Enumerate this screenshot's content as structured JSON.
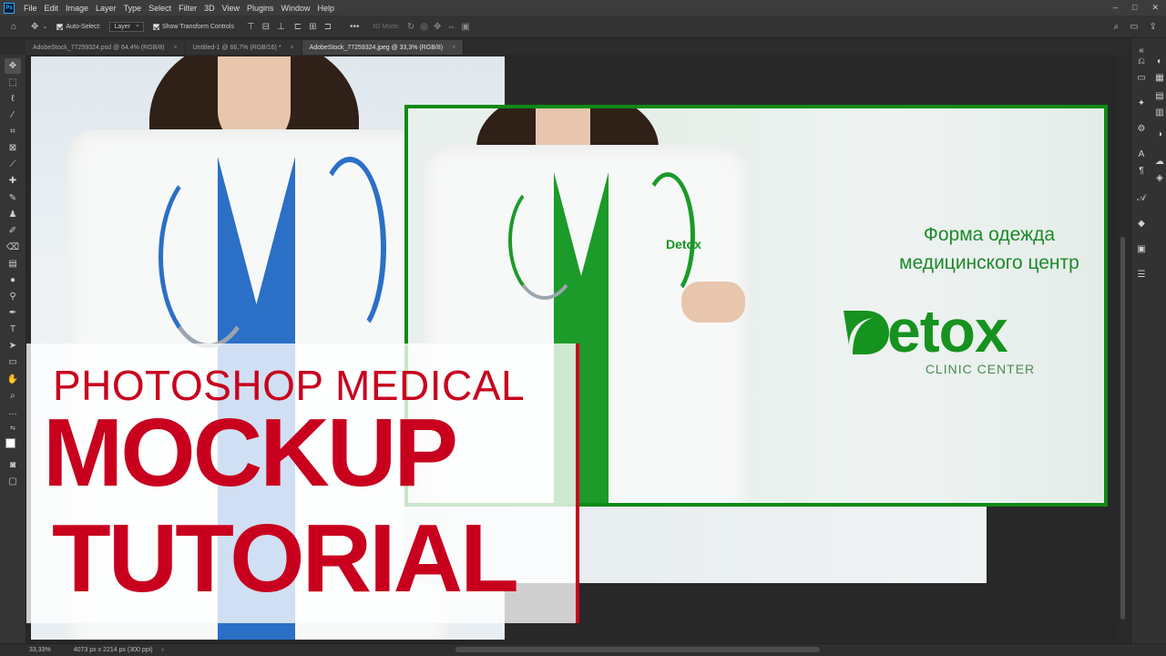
{
  "menubar": {
    "app_icon": "Ps",
    "items": [
      "File",
      "Edit",
      "Image",
      "Layer",
      "Type",
      "Select",
      "Filter",
      "3D",
      "View",
      "Plugins",
      "Window",
      "Help"
    ],
    "window_controls": [
      "–",
      "□",
      "✕"
    ]
  },
  "options": {
    "auto_select_label": "Auto-Select:",
    "auto_select_value": "Layer",
    "transform_label": "Show Transform Controls",
    "mode_3d_label": "3D Mode:"
  },
  "tabs": [
    {
      "label": "AdobeStock_77259324.psd @ 64,4% (RGB/8)",
      "close": "×"
    },
    {
      "label": "Untitled-1 @ 66,7% (RGB/16) *",
      "close": "×"
    },
    {
      "label": "AdobeStock_77259324.jpeg @ 33,3% (RGB/8)",
      "close": "×"
    }
  ],
  "tools": [
    "move-tool",
    "marquee-tool",
    "lasso-tool",
    "quick-select-tool",
    "crop-tool",
    "frame-tool",
    "eyedropper-tool",
    "healing-tool",
    "brush-tool",
    "clone-stamp-tool",
    "history-brush-tool",
    "eraser-tool",
    "gradient-tool",
    "blur-tool",
    "dodge-tool",
    "pen-tool",
    "type-tool",
    "path-select-tool",
    "rectangle-tool",
    "hand-tool",
    "zoom-tool",
    "more-tools"
  ],
  "overlay": {
    "line1": "PHOTOSHOP MEDICAL",
    "line2": "MOCKUP",
    "line3": "TUTORIAL"
  },
  "mockup": {
    "caption_line1": "Форма одежда",
    "caption_line2": "медицинского центр",
    "logo_word": "etox",
    "logo_sub": "CLINIC CENTER",
    "chest_logo": "Detox"
  },
  "statusbar": {
    "zoom": "33,33%",
    "dimensions": "4073 px x 2214 px (300 ppi)",
    "arrow": "›"
  },
  "colors": {
    "accent_red": "#c8001e",
    "brand_green": "#16921f",
    "border_green": "#0f8a16"
  }
}
